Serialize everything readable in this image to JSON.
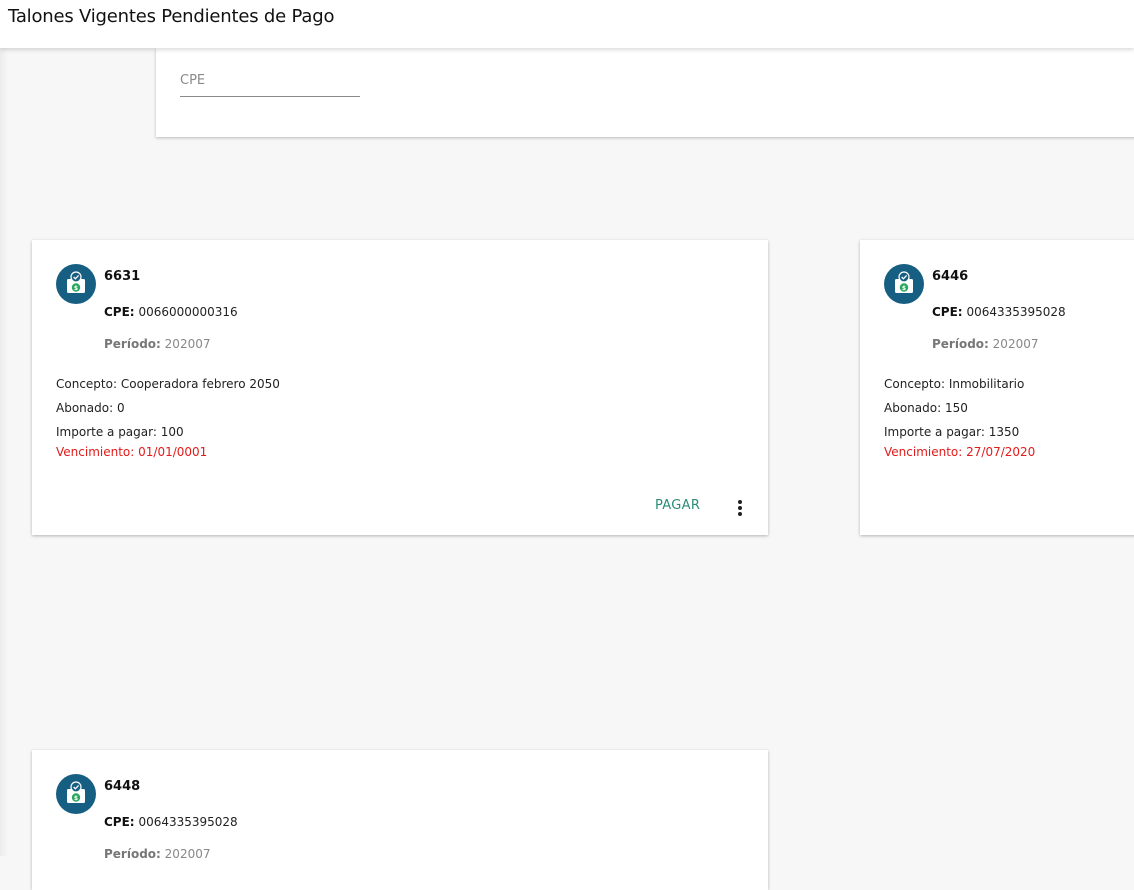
{
  "header": {
    "title": "Talones Vigentes Pendientes de Pago"
  },
  "filter": {
    "cpe_placeholder": "CPE"
  },
  "labels": {
    "cpe": "CPE:",
    "periodo": "Período:",
    "concepto": "Concepto:",
    "abonado": "Abonado:",
    "importe": "Importe a pagar:",
    "vencimiento": "Vencimiento:",
    "pay": "PAGAR"
  },
  "icons": {
    "card_avatar": "money-bag-check-icon",
    "more": "more-vert-icon"
  },
  "colors": {
    "avatar_bg": "#175e83",
    "pay_action": "#2a8c78",
    "due_date": "#e21b1b"
  },
  "cards": [
    {
      "number": "6631",
      "cpe": "0066000000316",
      "periodo": "202007",
      "concepto": "Cooperadora febrero 2050",
      "abonado": "0",
      "importe": "100",
      "vencimiento": "01/01/0001"
    },
    {
      "number": "6446",
      "cpe": "0064335395028",
      "periodo": "202007",
      "concepto": "Inmobilitario",
      "abonado": "150",
      "importe": "1350",
      "vencimiento": "27/07/2020"
    },
    {
      "number": "6448",
      "cpe": "0064335395028",
      "periodo": "202007"
    }
  ]
}
